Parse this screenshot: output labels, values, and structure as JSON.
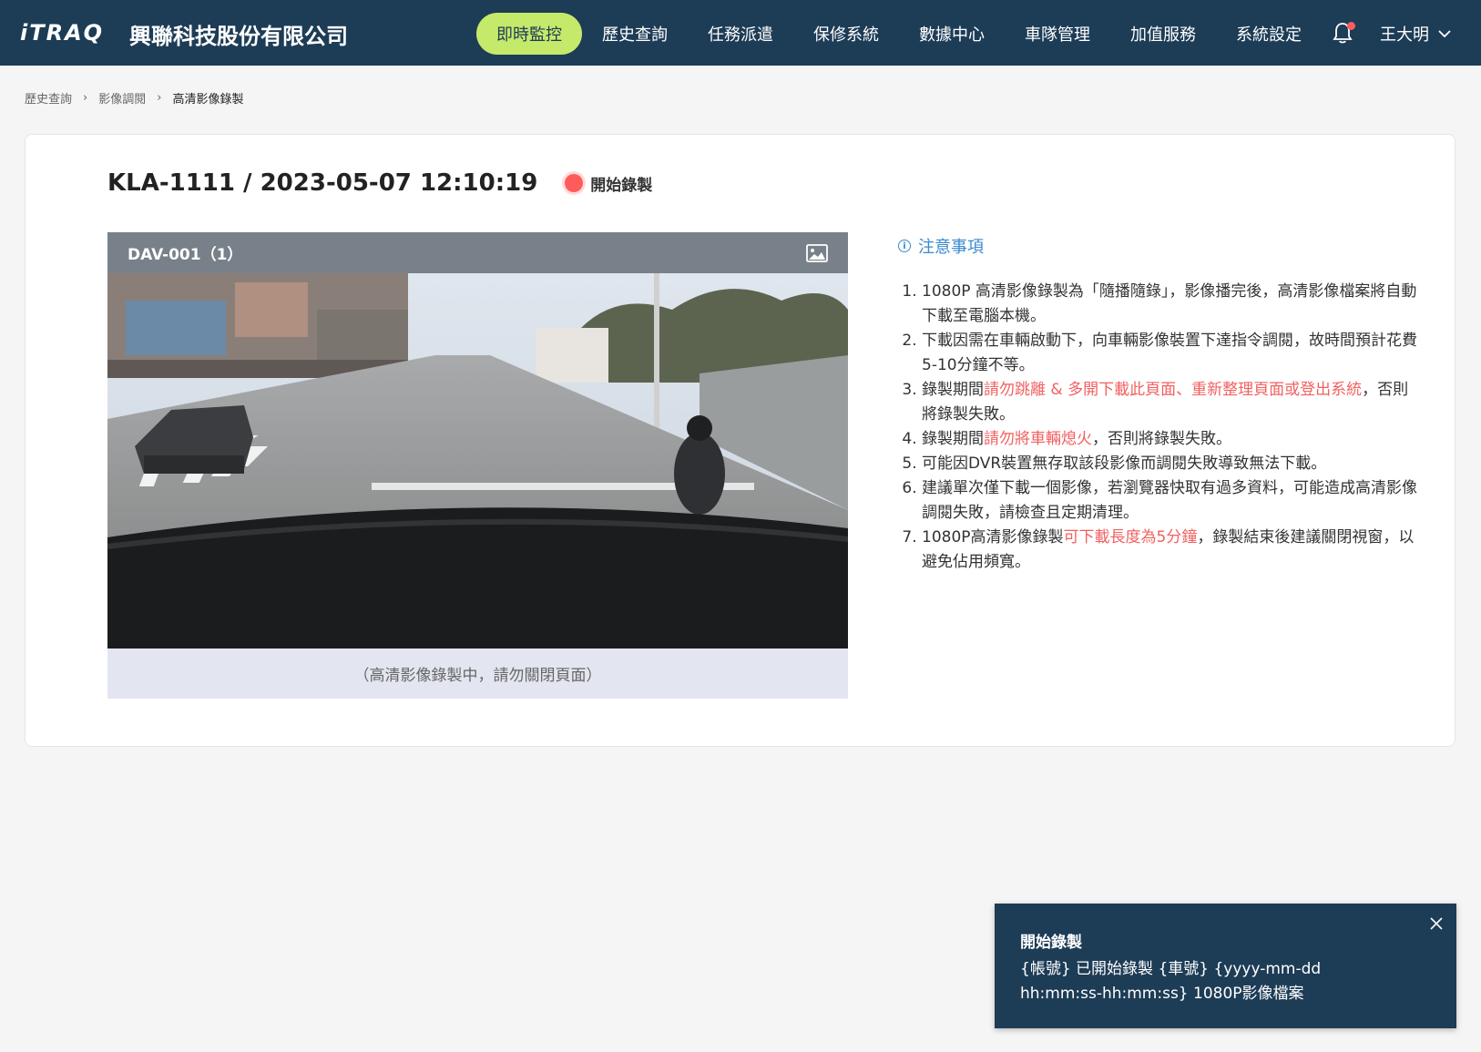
{
  "app": {
    "logo_text": "iTRAQ",
    "company_name": "興聯科技股份有限公司"
  },
  "nav": {
    "items": [
      {
        "label": "即時監控",
        "active": true
      },
      {
        "label": "歷史查詢"
      },
      {
        "label": "任務派遣"
      },
      {
        "label": "保修系統"
      },
      {
        "label": "數據中心"
      },
      {
        "label": "車隊管理"
      },
      {
        "label": "加值服務"
      },
      {
        "label": "系統設定"
      }
    ],
    "user_name": "王大明"
  },
  "breadcrumb": {
    "items": [
      "歷史查詢",
      "影像調閱",
      "高清影像錄製"
    ]
  },
  "record": {
    "title": "KLA-1111 / 2023-05-07 12:10:19",
    "status_label": "開始錄製"
  },
  "video": {
    "channel_label": "DAV-001（1）",
    "footer_note": "（高清影像錄製中，請勿關閉頁面）"
  },
  "notes": {
    "title": "注意事項",
    "items": [
      {
        "parts": [
          "1080P 高清影像錄製為「隨播隨錄」，影像播完後，高清影像檔案將自動下載至電腦本機。"
        ]
      },
      {
        "parts": [
          "下載因需在車輛啟動下，向車輛影像裝置下達指令調閱，故時間預計花費5-10分鐘不等。"
        ]
      },
      {
        "parts": [
          " 錄製期間",
          "請勿跳離 & 多開下載此頁面、重新整理頁面或登出系統",
          "，否則將錄製失敗。"
        ]
      },
      {
        "parts": [
          "錄製期間",
          "請勿將車輛熄火",
          "，否則將錄製失敗。"
        ]
      },
      {
        "parts": [
          "可能因DVR裝置無存取該段影像而調閱失敗導致無法下載。"
        ]
      },
      {
        "parts": [
          "建議單次僅下載一個影像，若瀏覽器快取有過多資料，可能造成高清影像調閱失敗，請檢查且定期清理。"
        ]
      },
      {
        "parts": [
          "1080P高清影像錄製",
          "可下載長度為5分鐘",
          "，錄製結束後建議關閉視窗，以避免佔用頻寬。"
        ]
      }
    ]
  },
  "toast": {
    "title": "開始錄製",
    "body": "{帳號} 已開始錄製 {車號} {yyyy-mm-dd hh:mm:ss-hh:mm:ss} 1080P影像檔案"
  },
  "colors": {
    "header_bg": "#1d3c56",
    "active_nav": "#c5e96a",
    "accent_blue": "#3a8ad0",
    "warning_red": "#f26060",
    "record_red": "#ff5b5b"
  }
}
